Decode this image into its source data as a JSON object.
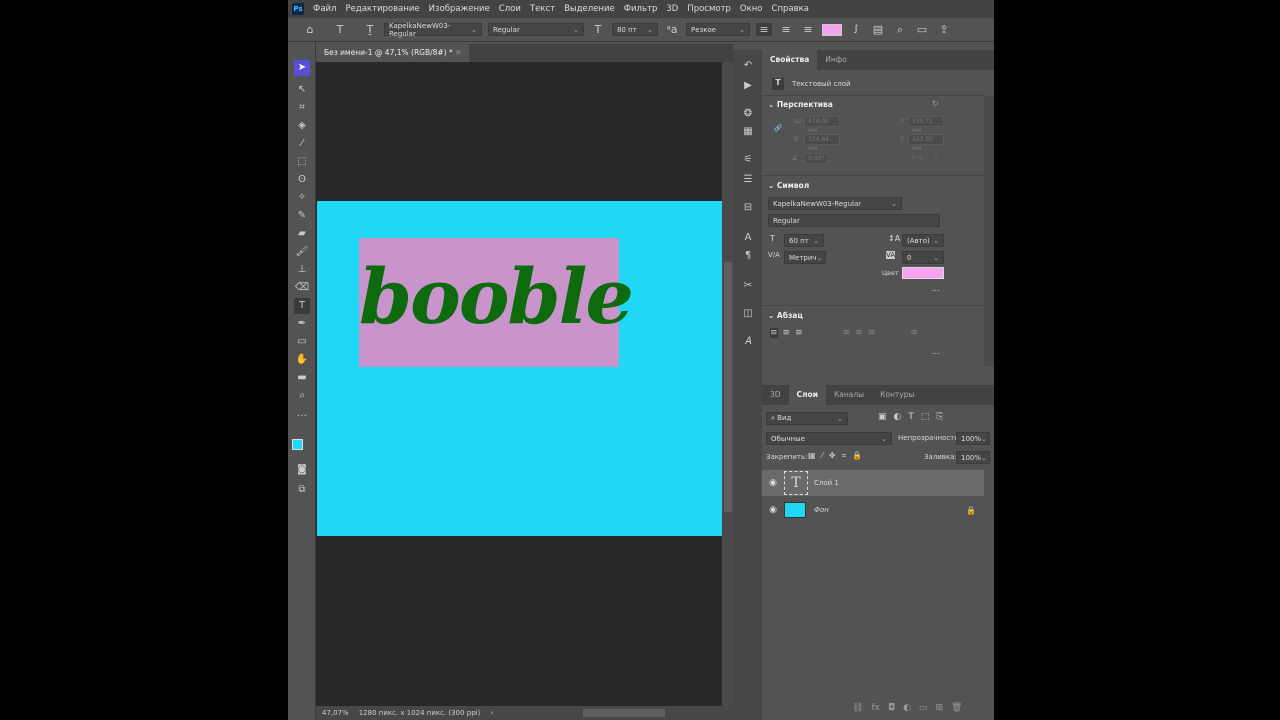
{
  "app": {
    "logo": "Ps"
  },
  "menu": [
    "Файл",
    "Редактирование",
    "Изображение",
    "Слои",
    "Текст",
    "Выделение",
    "Фильтр",
    "3D",
    "Просмотр",
    "Окно",
    "Справка"
  ],
  "options": {
    "font_family": "KapelkaNewW03-Regular",
    "font_style": "Regular",
    "font_size": "80 пт",
    "antialias": "Резкое",
    "color": "#f5a3f0"
  },
  "document": {
    "tab_title": "Без имени-1 @ 47,1% (RGB/8#) *",
    "text": "booble",
    "bg_color": "#1ed8f5",
    "box_color": "#c994cc",
    "text_color": "#0d6b0d"
  },
  "status": {
    "zoom": "47,07%",
    "info": "1280 пикс. x 1024 пикс. (300 ppi)"
  },
  "properties": {
    "tabs": [
      "Свойства",
      "Инфо"
    ],
    "layer_type": "Текстовый слой",
    "perspective": {
      "title": "Перспектива",
      "w_label": "Ш",
      "w": "474,02 мм",
      "h_label": "В",
      "h": "324,64 мм",
      "x_label": "X",
      "x": "150,71 мм",
      "y_label": "Y",
      "y": "163,92 мм",
      "angle": "0,00°"
    },
    "character": {
      "title": "Символ",
      "font": "KapelkaNewW03-Regular",
      "style": "Regular",
      "size": "60 пт",
      "leading": "(Авто)",
      "kerning": "Метрич",
      "tracking": "0",
      "color_label": "Цвет",
      "color": "#f5a3f0",
      "more": "..."
    },
    "paragraph": {
      "title": "Абзац",
      "more": "..."
    }
  },
  "layers": {
    "tabs": [
      "3D",
      "Слои",
      "Каналы",
      "Контуры"
    ],
    "filter": "Вид",
    "blend": "Обычные",
    "opacity_label": "Непрозрачность:",
    "opacity": "100%",
    "lock_label": "Закрепить:",
    "fill_label": "Заливка:",
    "fill": "100%",
    "items": [
      {
        "name": "Слой 1",
        "thumb": "T"
      },
      {
        "name": "Фон",
        "color": "#1ed8f5"
      }
    ]
  }
}
